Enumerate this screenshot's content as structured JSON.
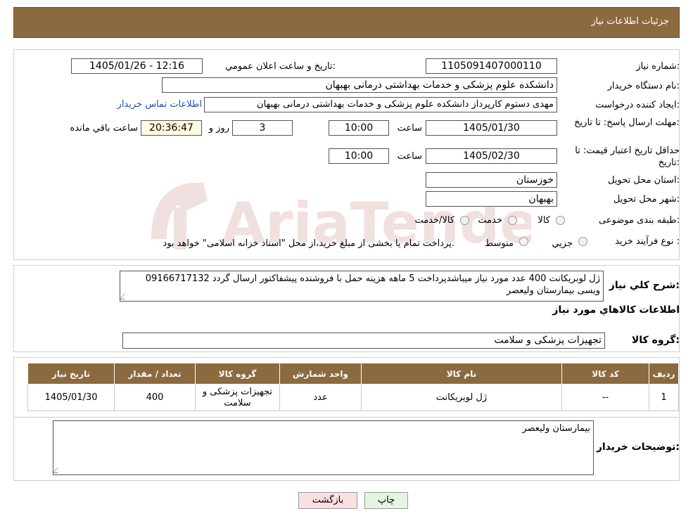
{
  "header": {
    "title": "جزئیات اطلاعات نیاز"
  },
  "form": {
    "need_number_label": "شماره نیاز:",
    "need_number": "1105091407000110",
    "announce_label": "تاریخ و ساعت اعلان عمومي:",
    "announce_value": "1405/01/26 - 12:16",
    "buyer_org_label": "نام دستگاه خریدار:",
    "buyer_org": "دانشکده علوم پزشکی و خدمات بهداشتی  درمانی بهبهان",
    "creator_label": "ایجاد کننده درخواست:",
    "creator": "مهدی دستوم کارپرداز دانشکده علوم پزشکی و خدمات بهداشتی  درمانی بهبهان",
    "contact_link": "اطلاعات تماس خریدار",
    "deadline_label": "مهلت ارسال پاسخ: تا تاریخ:",
    "deadline_date": "1405/01/30",
    "time_label": "ساعت",
    "deadline_time": "10:00",
    "days_value": "3",
    "days_label": "روز و",
    "remaining_time": "20:36:47",
    "remaining_label": "ساعت باقي مانده",
    "validity_label": "حداقل تاریخ اعتبار قیمت: تا تاریخ:",
    "validity_date": "1405/02/30",
    "validity_time": "10:00",
    "province_label": "استان محل تحویل:",
    "province": "خوزستان",
    "city_label": "شهر محل تحویل:",
    "city": "بهبهان",
    "category_label": "طبقه بندی موضوعی:",
    "category_options": [
      "کالا",
      "خدمت",
      "کالا/خدمت"
    ],
    "process_label": "نوع فرآیند خرید :",
    "process_options": [
      "جزیي",
      "متوسط"
    ],
    "process_note": "پرداخت تمام یا بخشی از مبلغ خرید،از محل \"اسناد خزانه اسلامی\" خواهد بود."
  },
  "summary": {
    "label": "شرح کلي نیاز:",
    "text": "ژل لوبریکانت 400 عدد مورد نیاز میباشدپرداخت 5 ماهه هزینه حمل با فروشنده پیشفاکتور ارسال گردد 09166717132 ویسی بیمارستان ولیعصر"
  },
  "goods": {
    "section_title": "اطلاعات کالاهاي مورد نیاز",
    "group_label": "گروه کالا:",
    "group_value": "تجهیزات پزشکی و سلامت",
    "columns": [
      "ردیف",
      "کد کالا",
      "نام کالا",
      "واحد شمارش",
      "گروه کالا",
      "تعداد / مقدار",
      "تاریخ نیاز"
    ],
    "rows": [
      [
        "1",
        "--",
        "ژل لوبریکانت",
        "عدد",
        "تجهیزات پزشکی و سلامت",
        "400",
        "1405/01/30"
      ]
    ]
  },
  "buyer_notes": {
    "label": "توضیحات خریدار:",
    "text": "بیمارستان ولیعصر"
  },
  "buttons": {
    "back": "بازگشت",
    "print": "چاپ"
  },
  "watermark": {
    "text": "AriaTender.neT"
  }
}
